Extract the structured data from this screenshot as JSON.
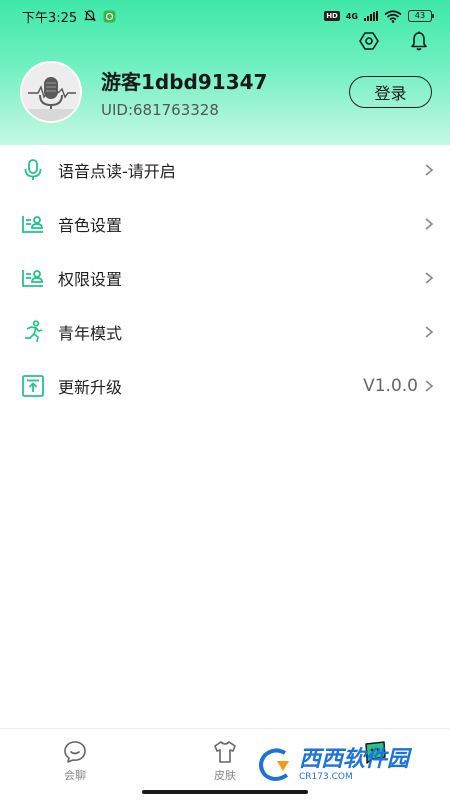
{
  "status_bar": {
    "time": "下午3:25",
    "network": "4G",
    "hd": "HD",
    "battery": "43"
  },
  "profile": {
    "username": "游客1dbd91347",
    "uid": "UID:681763328",
    "login_label": "登录"
  },
  "menu": {
    "items": [
      {
        "label": "语音点读-请开启",
        "value": "",
        "icon": "microphone-icon"
      },
      {
        "label": "音色设置",
        "value": "",
        "icon": "voice-card-icon"
      },
      {
        "label": "权限设置",
        "value": "",
        "icon": "permission-card-icon"
      },
      {
        "label": "青年模式",
        "value": "",
        "icon": "running-person-icon"
      },
      {
        "label": "更新升级",
        "value": "V1.0.0",
        "icon": "upload-icon"
      }
    ]
  },
  "tabbar": {
    "tabs": [
      {
        "label": "会聊",
        "active": false
      },
      {
        "label": "皮肤",
        "active": false
      },
      {
        "label": "",
        "active": true
      }
    ]
  },
  "watermark": {
    "main": "西西软件园",
    "sub": "CR173.COM"
  },
  "colors": {
    "accent": "#23c48a",
    "header_top": "#3ee8a8",
    "header_bottom": "#c6f8e4"
  }
}
